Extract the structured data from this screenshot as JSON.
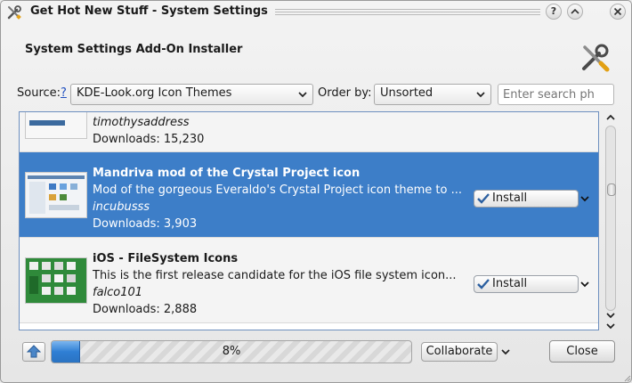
{
  "window": {
    "title": "Get Hot New Stuff - System Settings",
    "help_btn": "?",
    "min_btn": "^",
    "close_btn": "x"
  },
  "header": {
    "title": "System Settings Add-On Installer"
  },
  "filters": {
    "source_label": "Source:",
    "source_help": "?",
    "source_value": "KDE-Look.org Icon Themes",
    "order_label": "Order by:",
    "order_value": "Unsorted",
    "search_placeholder": "Enter search ph"
  },
  "items": [
    {
      "name": "",
      "description": "",
      "author": "timothysaddress",
      "downloads": "Downloads: 15,230",
      "selected": false
    },
    {
      "name": "Mandriva mod of the Crystal Project icon",
      "description": "Mod of the gorgeous Everaldo's Crystal Project icon theme to ...",
      "author": "incubusss",
      "downloads": "Downloads: 3,903",
      "install_label": "Install",
      "selected": true
    },
    {
      "name": "iOS - FileSystem Icons",
      "description": "This is the first release candidate for the iOS file system icon...",
      "author": "falco101",
      "downloads": "Downloads: 2,888",
      "install_label": "Install",
      "selected": false
    }
  ],
  "bottom": {
    "progress_percent": 8,
    "progress_text": "8%",
    "collaborate_label": "Collaborate",
    "close_label": "Close"
  },
  "colors": {
    "selection": "#3d7ec8",
    "progress": "#2f7fd4"
  }
}
